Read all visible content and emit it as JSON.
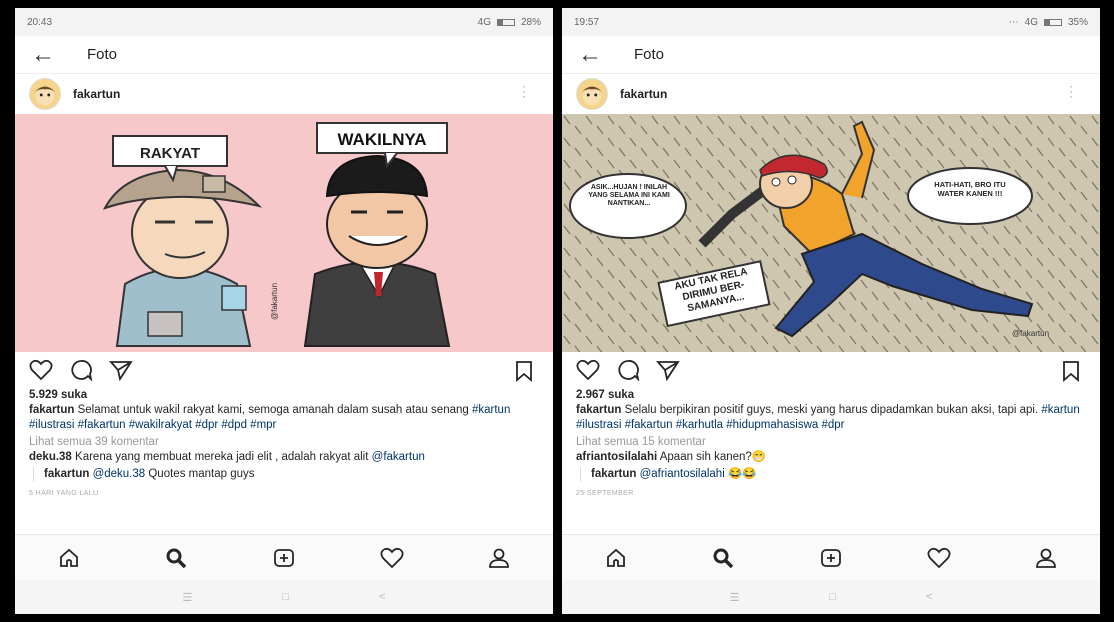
{
  "screens": [
    {
      "status": {
        "time": "20:43",
        "network": "4G",
        "battery": "28%"
      },
      "appbar": {
        "title": "Foto"
      },
      "post": {
        "username": "fakartun",
        "image_labels": [
          "RAKYAT",
          "WAKILNYA"
        ],
        "signature": "@fakartun",
        "likes": "5.929 suka",
        "caption_user": "fakartun",
        "caption_text": " Selamat untuk wakil rakyat kami, semoga amanah dalam susah atau senang ",
        "caption_tags": "#kartun #ilustrasi #fakartun #wakilrakyat #dpr #dpd #mpr",
        "view_comments": "Lihat semua 39 komentar",
        "comment_user": "deku.38",
        "comment_text": " Karena yang membuat mereka jadi elit , adalah rakyat alit ",
        "comment_mention": "@fakartun",
        "reply_user": "fakartun",
        "reply_text": " Quotes mantap guys",
        "reply_mention": " @deku.38",
        "timestamp": "5 HARI YANG LALU"
      }
    },
    {
      "status": {
        "time": "19:57",
        "network": "4G",
        "battery": "35%"
      },
      "appbar": {
        "title": "Foto"
      },
      "post": {
        "username": "fakartun",
        "image_labels": [
          "ASIK...HUJAN ! INILAH YANG SELAMA INI KAMI NANTIKAN...",
          "HATI-HATI, BRO ITU WATER KANEN !!!",
          "AKU TAK RELA DIRIMU BER- SAMANYA..."
        ],
        "signature": "@fakartun",
        "likes": "2.967 suka",
        "caption_user": "fakartun",
        "caption_text": " Selalu berpikiran positif  guys, meski yang harus dipadamkan bukan aksi, tapi api. ",
        "caption_tags": "#kartun #ilustrasi #fakartun #karhutla #hidupmahasiswa #dpr",
        "view_comments": "Lihat semua 15 komentar",
        "comment_user": "afriantosilalahi",
        "comment_text": " Apaan sih kanen?😁",
        "comment_mention": "",
        "reply_user": "fakartun",
        "reply_text": " 😂😂",
        "reply_mention": " @afriantosilalahi",
        "timestamp": "25 SEPTEMBER"
      }
    }
  ],
  "icons": [
    "arrow-left-icon",
    "more-vert-icon",
    "heart-icon",
    "comment-icon",
    "share-icon",
    "bookmark-icon",
    "home-icon",
    "search-icon",
    "add-icon",
    "activity-heart-icon",
    "profile-icon",
    "menu-icon",
    "square-icon",
    "back-chevron-icon"
  ],
  "colors": {
    "left_bg": "#f6c8ca",
    "right_bg": "#cfc6b0",
    "tag": "#003569",
    "meta_gray": "#999999"
  }
}
